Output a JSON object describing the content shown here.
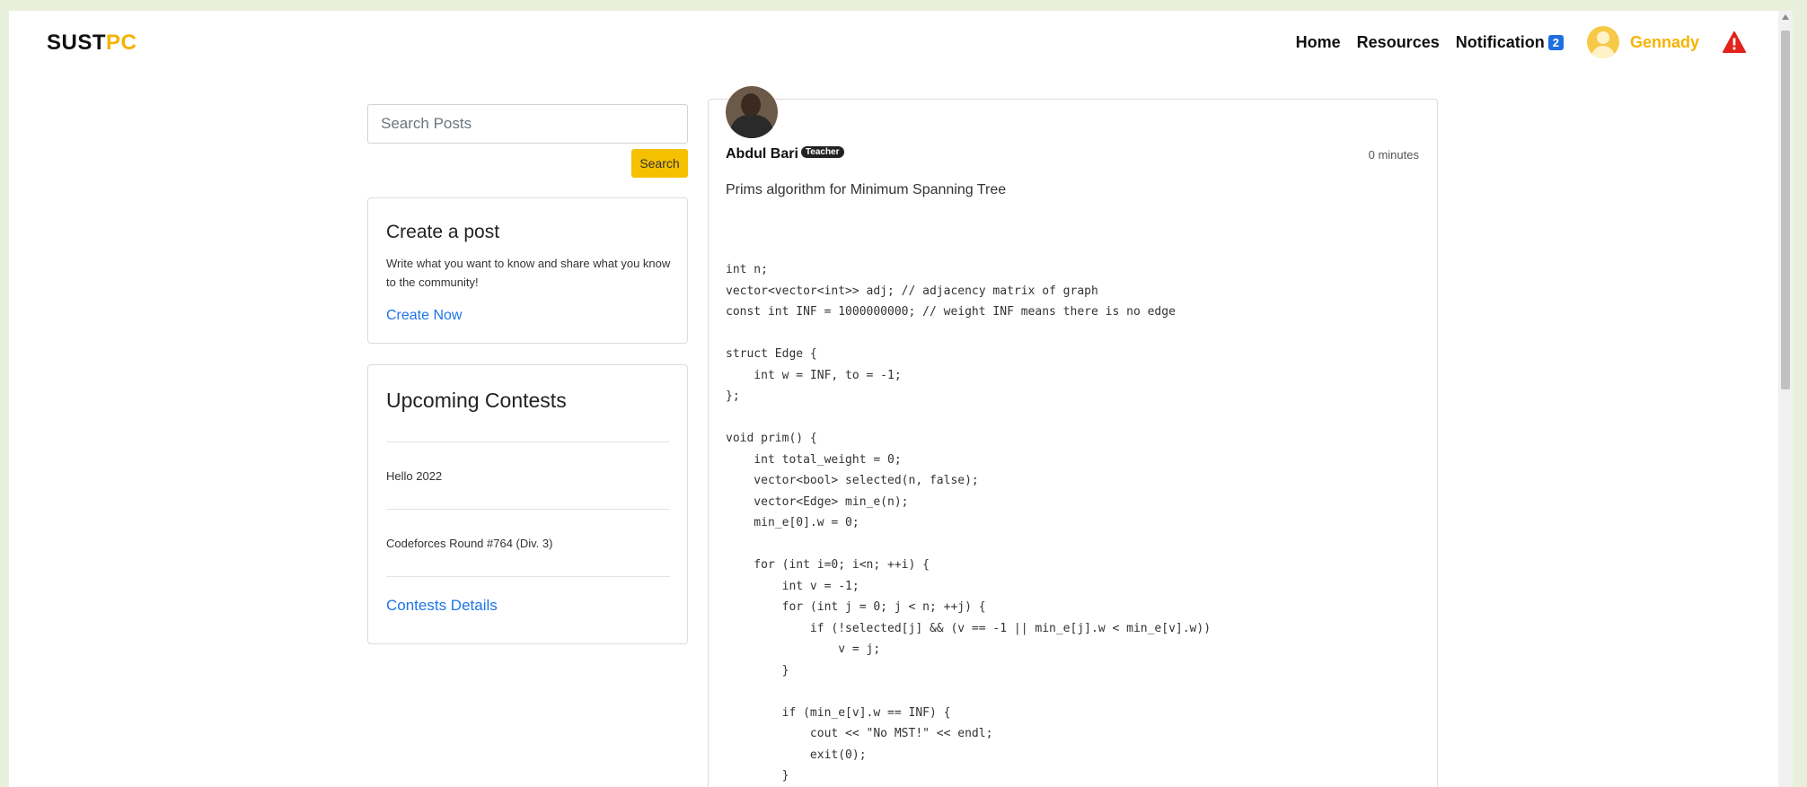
{
  "brand": {
    "part1": "SUST",
    "part2": "PC"
  },
  "nav": {
    "home": "Home",
    "resources": "Resources",
    "notification": "Notification",
    "notification_count": "2",
    "username": "Gennady"
  },
  "search": {
    "placeholder": "Search Posts",
    "button": "Search"
  },
  "create_post": {
    "title": "Create a post",
    "description": "Write what you want to know and share what you know to the community!",
    "link": "Create Now"
  },
  "contests": {
    "title": "Upcoming Contests",
    "items": [
      "Hello 2022",
      "Codeforces Round #764 (Div. 3)"
    ],
    "details_link": "Contests Details"
  },
  "post": {
    "author": "Abdul Bari",
    "role": "Teacher",
    "time": "0 minutes",
    "title": "Prims algorithm for Minimum Spanning Tree",
    "code": "int n;\nvector<vector<int>> adj; // adjacency matrix of graph\nconst int INF = 1000000000; // weight INF means there is no edge\n\nstruct Edge {\n    int w = INF, to = -1;\n};\n\nvoid prim() {\n    int total_weight = 0;\n    vector<bool> selected(n, false);\n    vector<Edge> min_e(n);\n    min_e[0].w = 0;\n\n    for (int i=0; i<n; ++i) {\n        int v = -1;\n        for (int j = 0; j < n; ++j) {\n            if (!selected[j] && (v == -1 || min_e[j].w < min_e[v].w))\n                v = j;\n        }\n\n        if (min_e[v].w == INF) {\n            cout << \"No MST!\" << endl;\n            exit(0);\n        }"
  },
  "colors": {
    "accent": "#f5c000",
    "link": "#1e74e8",
    "background": "#e8f0dc",
    "badge": "#1e6fe0",
    "warning": "#e0241c"
  },
  "icons": {
    "user": "user-avatar-icon",
    "warning": "warning-triangle-icon"
  }
}
